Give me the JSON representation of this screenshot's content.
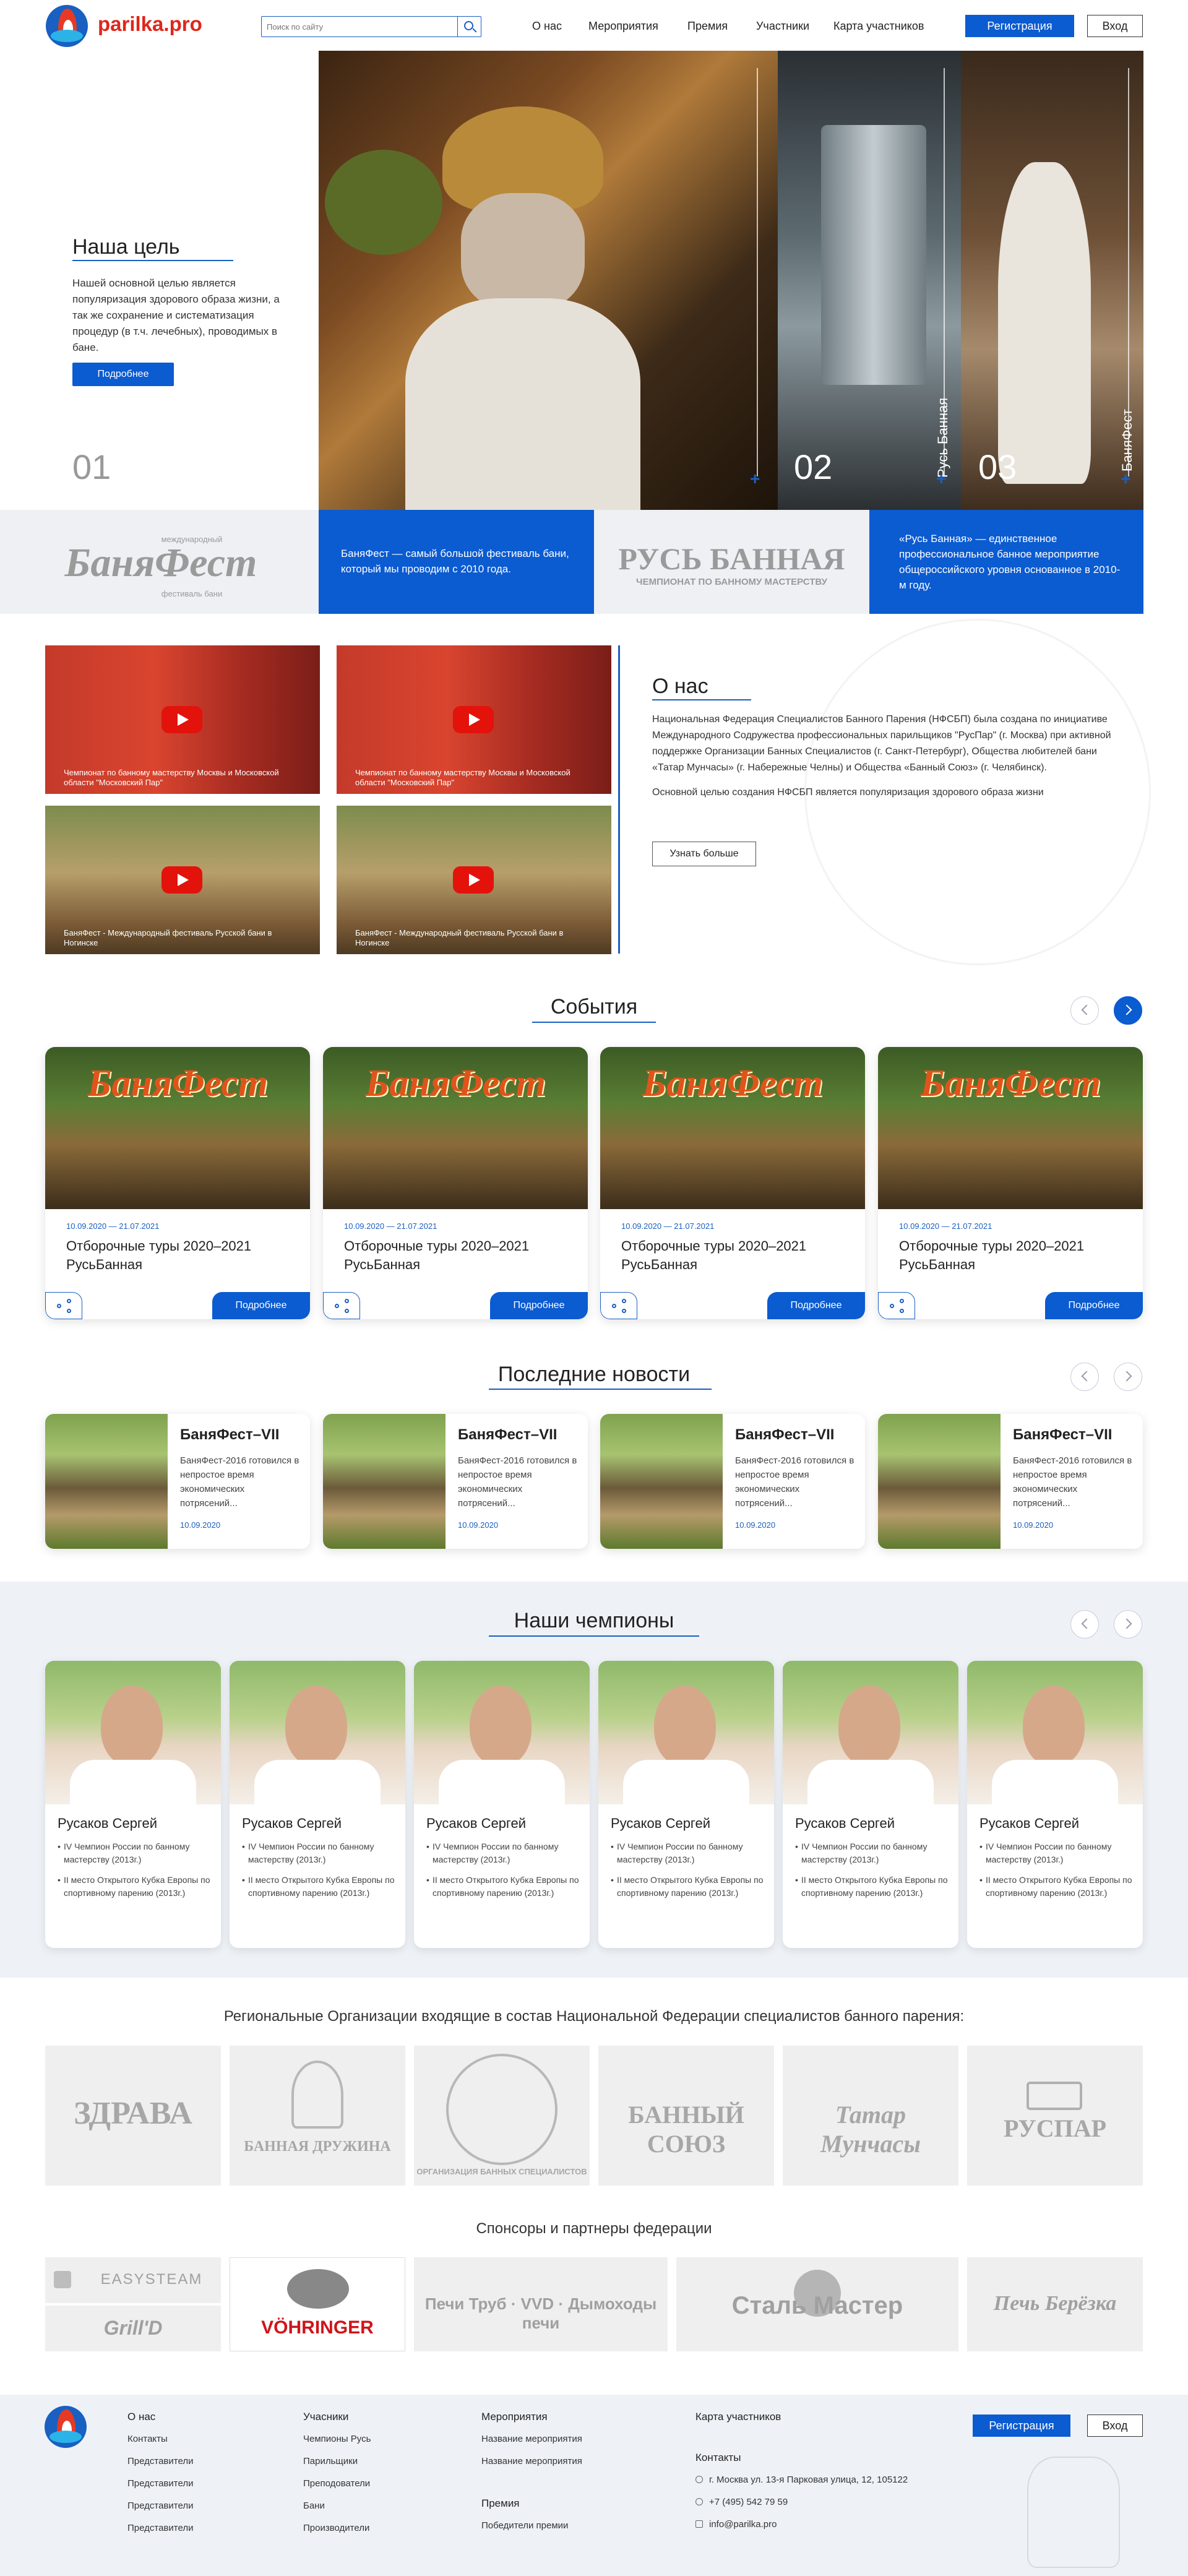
{
  "header": {
    "logo": "parilka.pro",
    "search_placeholder": "Поиск по сайту",
    "nav": [
      "О нас",
      "Мероприятия",
      "Премия",
      "Участники",
      "Карта участников"
    ],
    "register": "Регистрация",
    "login": "Вход"
  },
  "hero": {
    "goal_title": "Наша цель",
    "goal_text": "Нашей основной целью является популяризация здорового образа жизни, а так же сохранение и систематизация процедур (в т.ч. лечебных), проводимых в бане.",
    "goal_button": "Подробнее",
    "slides": [
      {
        "num": "01"
      },
      {
        "num": "02",
        "label": "Русь Банная"
      },
      {
        "num": "03",
        "label": "БаняФест"
      }
    ]
  },
  "strip": {
    "logo1_main": "БаняФест",
    "logo1_top": "международный",
    "logo1_bottom": "фестиваль бани",
    "text1": "БаняФест — самый большой фестиваль бани, который мы проводим с 2010 года.",
    "logo2_main": "РУСЬ БАННАЯ",
    "logo2_sub": "ЧЕМПИОНАТ ПО БАННОМУ МАСТЕРСТВУ",
    "text2": "«Русь Банная» — единственное профессиональное банное мероприятие общероссийского уровня основанное в 2010-м году."
  },
  "videos": [
    {
      "caption": "Чемпионат по банному мастерству Москвы и Московской области \"Московский Пар\""
    },
    {
      "caption": "Чемпионат по банному мастерству Москвы и Московской области \"Московский Пар\""
    },
    {
      "caption": "БаняФест - Международный фестиваль Русской бани в Ногинске"
    },
    {
      "caption": "БаняФест - Международный фестиваль Русской бани в Ногинске"
    }
  ],
  "about": {
    "title": "О нас",
    "p1": "Национальная Федерация Специалистов Банного Парения (НФСБП) была создана по инициативе Международного Содружества профессиональных парильщиков \"РусПар\" (г. Москва) при активной поддержке Организации Банных Специалистов (г. Санкт-Петербург), Общества любителей бани «Татар Мунчасы» (г. Набережные Челны) и Общества «Банный Союз» (г. Челябинск).",
    "p2": "Основной целью создания НФСБП является популяризация здорового образа жизни",
    "button": "Узнать больше"
  },
  "events": {
    "title": "События",
    "brand": "БаняФест",
    "items": [
      {
        "date": "10.09.2020 — 21.07.2021",
        "title": "Отборочные туры 2020–2021 РусьБанная",
        "more": "Подробнее"
      },
      {
        "date": "10.09.2020 — 21.07.2021",
        "title": "Отборочные туры 2020–2021 РусьБанная",
        "more": "Подробнее"
      },
      {
        "date": "10.09.2020 — 21.07.2021",
        "title": "Отборочные туры 2020–2021 РусьБанная",
        "more": "Подробнее"
      },
      {
        "date": "10.09.2020 — 21.07.2021",
        "title": "Отборочные туры 2020–2021 РусьБанная",
        "more": "Подробнее"
      }
    ]
  },
  "news": {
    "title": "Последние новости",
    "items": [
      {
        "title": "БаняФест–VII",
        "text": "БаняФест-2016 готовился в непростое время экономических потрясений...",
        "date": "10.09.2020"
      },
      {
        "title": "БаняФест–VII",
        "text": "БаняФест-2016 готовился в непростое время экономических потрясений...",
        "date": "10.09.2020"
      },
      {
        "title": "БаняФест–VII",
        "text": "БаняФест-2016 готовился в непростое время экономических потрясений...",
        "date": "10.09.2020"
      },
      {
        "title": "БаняФест–VII",
        "text": "БаняФест-2016 готовился в непростое время экономических потрясений...",
        "date": "10.09.2020"
      }
    ]
  },
  "champions": {
    "title": "Наши чемпионы",
    "items": [
      {
        "name": "Русаков Сергей",
        "a1": "IV Чемпион России по банному мастерству (2013г.)",
        "a2": "II место Открытого Кубка Европы по спортивному парению (2013г.)"
      },
      {
        "name": "Русаков Сергей",
        "a1": "IV Чемпион России по банному мастерству (2013г.)",
        "a2": "II место Открытого Кубка Европы по спортивному парению (2013г.)"
      },
      {
        "name": "Русаков Сергей",
        "a1": "IV Чемпион России по банному мастерству (2013г.)",
        "a2": "II место Открытого Кубка Европы по спортивному парению (2013г.)"
      },
      {
        "name": "Русаков Сергей",
        "a1": "IV Чемпион России по банному мастерству (2013г.)",
        "a2": "II место Открытого Кубка Европы по спортивному парению (2013г.)"
      },
      {
        "name": "Русаков Сергей",
        "a1": "IV Чемпион России по банному мастерству (2013г.)",
        "a2": "II место Открытого Кубка Европы по спортивному парению (2013г.)"
      },
      {
        "name": "Русаков Сергей",
        "a1": "IV Чемпион России по банному мастерству (2013г.)",
        "a2": "II место Открытого Кубка Европы по спортивному парению (2013г.)"
      }
    ]
  },
  "orgs": {
    "title": "Региональные Организации входящие в состав Национальной Федерации специалистов банного парения:",
    "items": [
      "ЗДРАВА",
      "БАННАЯ ДРУЖИНА",
      "ОРГАНИЗАЦИЯ БАННЫХ СПЕЦИАЛИСТОВ",
      "БАННЫЙ СОЮЗ",
      "Татар Мунчасы",
      "РУСПАР"
    ]
  },
  "sponsors": {
    "title": "Спонсоры и партнеры федерации",
    "items": [
      "EASYSTEAM",
      "Grill'D",
      "VÖHRINGER",
      "Печи Труб · VVD · Дымоходы печи",
      "Сталь Мастер",
      "Печь Берёзка"
    ]
  },
  "footer": {
    "col1": [
      "О нас",
      "Контакты",
      "Представители",
      "Представители",
      "Представители",
      "Представители"
    ],
    "col2": [
      "Учасники",
      "Чемпионы Русь",
      "Парильщики",
      "Преподователи",
      "Бани",
      "Производители"
    ],
    "col3a": [
      "Мероприятия",
      "Название мероприятия",
      "Название мероприятия"
    ],
    "col3b": [
      "Премия",
      "Победители премии"
    ],
    "map": "Карта участников",
    "contacts_title": "Контакты",
    "address": "г. Москва ул. 13-я Парковая улица, 12, 105122",
    "phone": "+7 (495) 542 79 59",
    "email": "info@parilka.pro",
    "register": "Регистрация",
    "login": "Вход"
  },
  "colors": {
    "accent": "#0b5bd1",
    "brand_red": "#e0261b"
  }
}
